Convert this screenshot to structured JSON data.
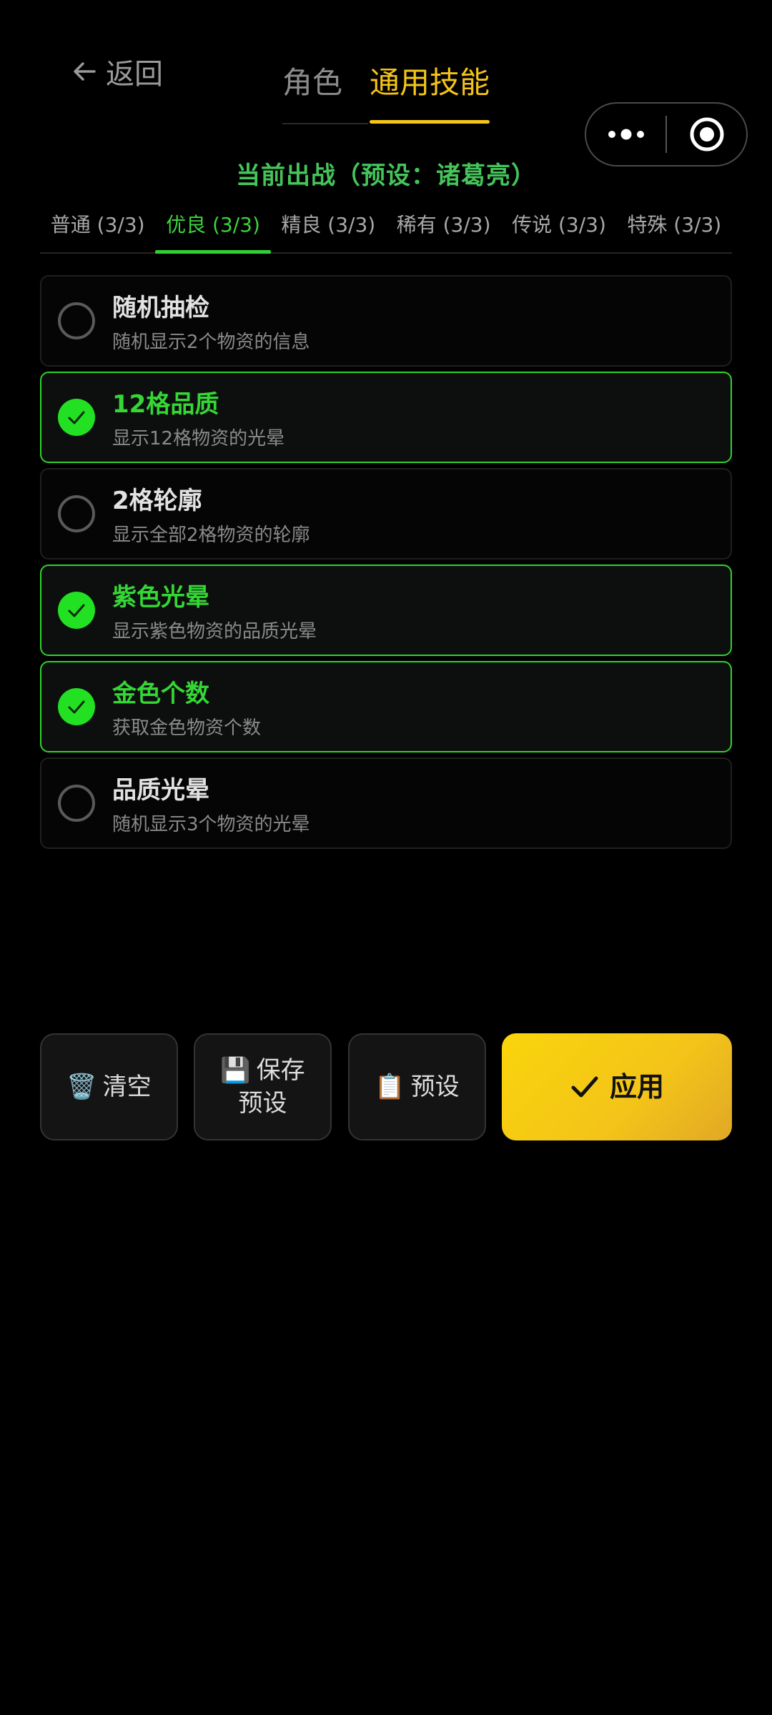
{
  "header": {
    "back_label": "返回",
    "tabs": [
      {
        "label": "角色",
        "active": false
      },
      {
        "label": "通用技能",
        "active": true
      }
    ]
  },
  "preset_title": "当前出战（预设：诸葛亮）",
  "rarity_tabs": [
    {
      "label": "普通 (3/3)",
      "active": false
    },
    {
      "label": "优良 (3/3)",
      "active": true
    },
    {
      "label": "精良 (3/3)",
      "active": false
    },
    {
      "label": "稀有 (3/3)",
      "active": false
    },
    {
      "label": "传说 (3/3)",
      "active": false
    },
    {
      "label": "特殊 (3/3)",
      "active": false
    }
  ],
  "skills": [
    {
      "name": "随机抽检",
      "desc": "随机显示2个物资的信息",
      "selected": false
    },
    {
      "name": "12格品质",
      "desc": "显示12格物资的光晕",
      "selected": true
    },
    {
      "name": "2格轮廓",
      "desc": "显示全部2格物资的轮廓",
      "selected": false
    },
    {
      "name": "紫色光晕",
      "desc": "显示紫色物资的品质光晕",
      "selected": true
    },
    {
      "name": "金色个数",
      "desc": "获取金色物资个数",
      "selected": true
    },
    {
      "name": "品质光晕",
      "desc": "随机显示3个物资的光晕",
      "selected": false
    }
  ],
  "buttons": {
    "clear": {
      "icon": "🗑️",
      "label": "清空"
    },
    "save": {
      "icon": "💾",
      "label_line1": "保存",
      "label_line2": "预设"
    },
    "preset": {
      "icon": "📋",
      "label": "预设"
    },
    "apply": {
      "label": "应用"
    }
  },
  "colors": {
    "accent_yellow": "#f5c518",
    "accent_green": "#2ed22e",
    "preset_green": "#45c45a"
  }
}
